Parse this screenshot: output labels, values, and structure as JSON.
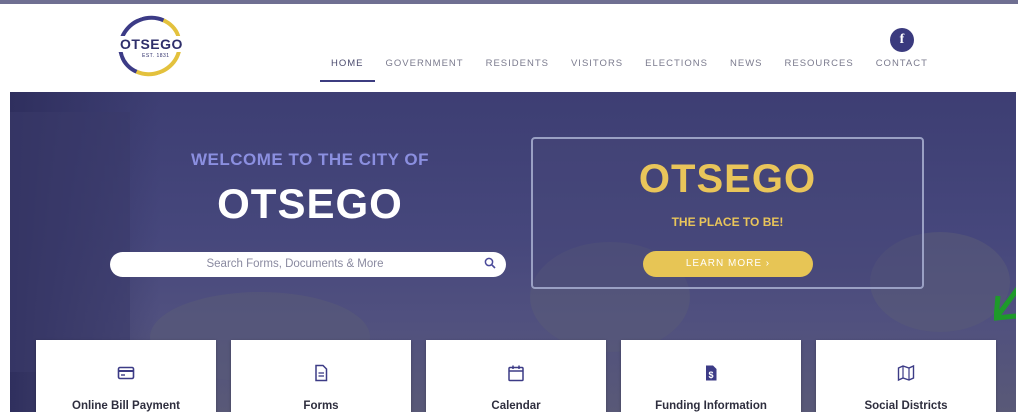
{
  "brand": {
    "logo_text": "OTSEGO",
    "logo_est": "EST. 1831",
    "colors": {
      "primary": "#3c3b86",
      "accent": "#e3c13d"
    }
  },
  "social": {
    "facebook_glyph": "f",
    "icon": "facebook-icon"
  },
  "nav": {
    "items": [
      "HOME",
      "GOVERNMENT",
      "RESIDENTS",
      "VISITORS",
      "ELECTIONS",
      "NEWS",
      "RESOURCES",
      "CONTACT"
    ],
    "active": "HOME"
  },
  "hero": {
    "welcome": "WELCOME TO THE CITY OF",
    "city": "OTSEGO",
    "search": {
      "placeholder": "Search Forms, Documents & More",
      "icon": "search-icon"
    },
    "promo": {
      "title": "OTSEGO",
      "subtitle": "THE PLACE TO BE!",
      "button_label": "LEARN MORE  ›"
    }
  },
  "cards": [
    {
      "label": "Online Bill Payment",
      "icon": "credit-card-icon"
    },
    {
      "label": "Forms",
      "icon": "document-icon"
    },
    {
      "label": "Calendar",
      "icon": "calendar-icon"
    },
    {
      "label": "Funding Information",
      "icon": "dollar-document-icon"
    },
    {
      "label": "Social Districts",
      "icon": "map-icon"
    }
  ]
}
